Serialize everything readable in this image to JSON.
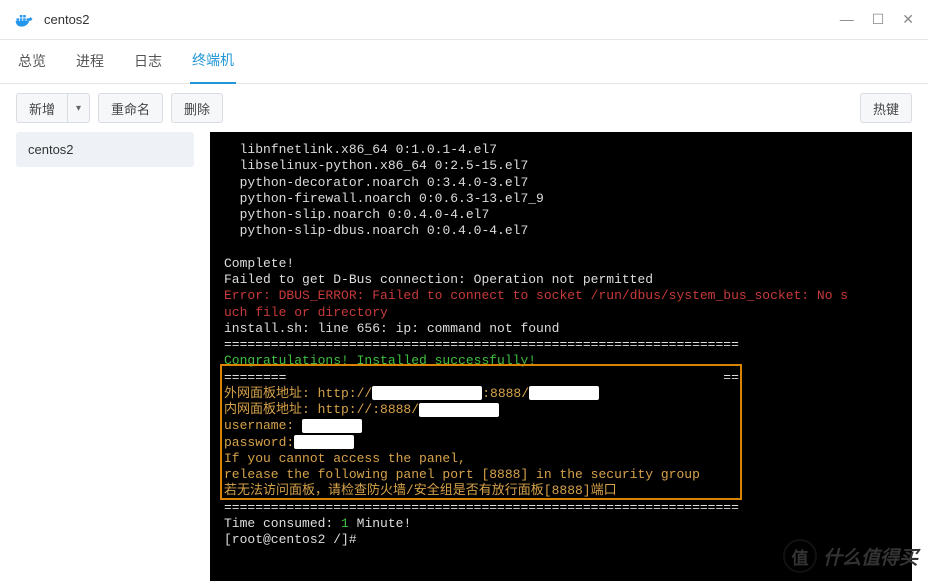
{
  "window": {
    "title": "centos2",
    "minimize_glyph": "—",
    "maximize_glyph": "☐",
    "close_glyph": "✕"
  },
  "tabs": {
    "overview": "总览",
    "process": "进程",
    "log": "日志",
    "terminal": "终端机"
  },
  "toolbar": {
    "new": "新增",
    "caret_glyph": "▾",
    "rename": "重命名",
    "delete": "删除",
    "hotkey": "热键"
  },
  "sidebar": {
    "items": [
      {
        "label": "centos2"
      }
    ]
  },
  "terminal": {
    "lines": {
      "pkg1": "  libnfnetlink.x86_64 0:1.0.1-4.el7",
      "pkg2": "  libselinux-python.x86_64 0:2.5-15.el7",
      "pkg3": "  python-decorator.noarch 0:3.4.0-3.el7",
      "pkg4": "  python-firewall.noarch 0:0.6.3-13.el7_9",
      "pkg5": "  python-slip.noarch 0:0.4.0-4.el7",
      "pkg6": "  python-slip-dbus.noarch 0:0.4.0-4.el7",
      "complete": "Complete!",
      "dbusfail": "Failed to get D-Bus connection: Operation not permitted",
      "err1": "Error: DBUS_ERROR: Failed to connect to socket /run/dbus/system_bus_socket: No s",
      "err2": "uch file or directory",
      "install_line": "install.sh: line 656: ip: command not found",
      "sep1": "==================================================================",
      "congrats": "Congratulations! Installed successfully!",
      "sep2_left": "========",
      "sep2_right": "==",
      "ext_label": "外网面板地址: http://",
      "ext_mid": ":8888/",
      "int_label": "内网面板地址: http://:8888/",
      "user_label": "username: ",
      "pass_label": "password:",
      "info1": "If you cannot access the panel,",
      "info2": "release the following panel port [8888] in the security group",
      "info3": "若无法访问面板，请检查防火墙/安全组是否有放行面板[8888]端口",
      "time_pre": "Time consumed: ",
      "time_val": "1",
      "time_post": " Minute!",
      "prompt": "[root@centos2 /]#"
    }
  },
  "watermark": {
    "badge": "值",
    "text": "什么值得买"
  }
}
